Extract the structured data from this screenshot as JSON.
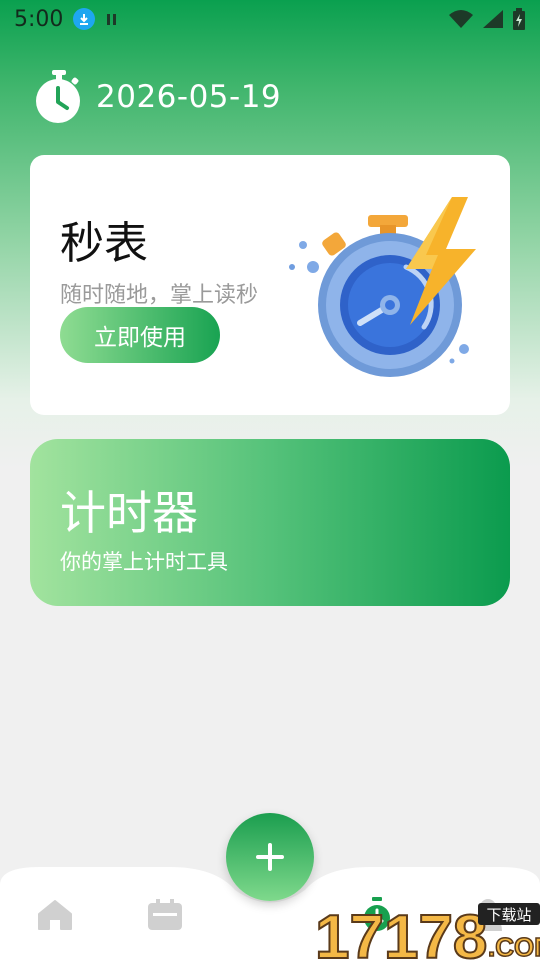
{
  "status_bar": {
    "time": "5:00",
    "icons": [
      "download-icon",
      "pause-icon",
      "wifi-icon",
      "signal-icon",
      "battery-icon"
    ]
  },
  "header": {
    "date": "2026-05-19",
    "icon": "stopwatch-icon"
  },
  "stopwatch_card": {
    "title": "秒表",
    "subtitle": "随时随地，掌上读秒",
    "button_label": "立即使用",
    "illustration": "stopwatch-lightning-illustration"
  },
  "timer_card": {
    "title": "计时器",
    "subtitle": "你的掌上计时工具"
  },
  "bottom_nav": {
    "items": [
      {
        "icon": "home-icon"
      },
      {
        "icon": "calendar-icon"
      },
      {
        "icon": "add-icon"
      },
      {
        "icon": "stopwatch-icon"
      },
      {
        "icon": "profile-icon"
      }
    ]
  },
  "watermark": {
    "brand": "17178",
    "tag": "下载站",
    "domain": ".COM"
  },
  "colors": {
    "primary_green": "#0aa04f",
    "light_green": "#8fdc92",
    "download_blue": "#1ea7f0",
    "lightning_orange": "#f5a623"
  }
}
